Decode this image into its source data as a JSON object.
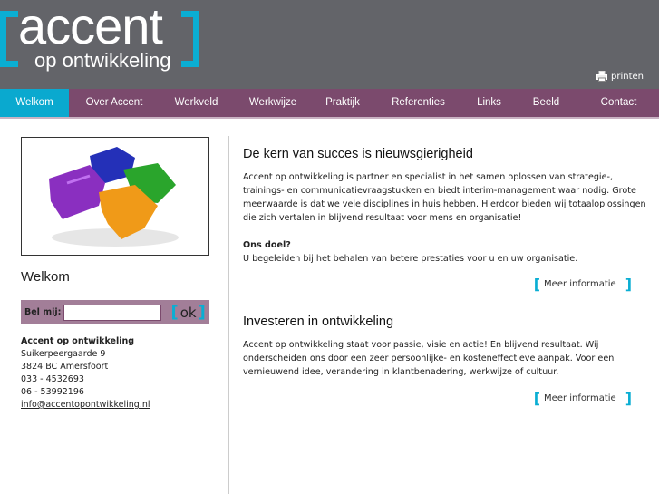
{
  "header": {
    "logo_text": "accent",
    "logo_subtext": "op ontwikkeling",
    "print_label": "printen",
    "print_icon": "printer-icon"
  },
  "nav": {
    "items": [
      {
        "label": "Welkom",
        "active": true
      },
      {
        "label": "Over Accent"
      },
      {
        "label": "Werkveld"
      },
      {
        "label": "Werkwijze"
      },
      {
        "label": "Praktijk"
      },
      {
        "label": "Referenties"
      },
      {
        "label": "Links"
      },
      {
        "label": "Beeld"
      },
      {
        "label": "Contact"
      }
    ]
  },
  "sidebar": {
    "image": "puzzle-pieces-image",
    "title": "Welkom",
    "callback": {
      "label": "Bel mij:",
      "value": "",
      "placeholder": "",
      "button": "ok"
    },
    "address": {
      "company": "Accent op ontwikkeling",
      "street": "Suikerpeergaarde 9",
      "city": "3824 BC Amersfoort",
      "phone1": "033 - 4532693",
      "phone2": "06 - 53992196",
      "email": "info@accentopontwikkeling.nl"
    }
  },
  "main": {
    "sections": [
      {
        "title": "De kern van succes is nieuwsgierigheid",
        "text": "Accent op ontwikkeling is partner en specialist in het samen oplossen van strategie-, trainings- en communicatievraagstukken en biedt interim-management waar nodig. Grote meerwaarde is dat we vele disciplines in huis hebben. Hierdoor bieden wij totaaloplossingen die zich vertalen in blijvend resultaat voor mens en organisatie!",
        "subtitle": "Ons doel?",
        "subtext": "U begeleiden bij het behalen van betere prestaties voor u en uw organisatie.",
        "more": "Meer informatie"
      },
      {
        "title": "Investeren in ontwikkeling",
        "text": "Accent op ontwikkeling staat voor passie, visie en actie! En blijvend resultaat. Wij onderscheiden ons door een zeer persoonlijke- en kosteneffectieve  aanpak.  Voor een vernieuwend idee, verandering in klantbenadering, werkwijze of cultuur.",
        "more": "Meer informatie"
      }
    ]
  },
  "colors": {
    "header": "#636469",
    "nav": "#7b4a6d",
    "accent": "#0aa9cf",
    "callback_bar": "#a27e98"
  }
}
